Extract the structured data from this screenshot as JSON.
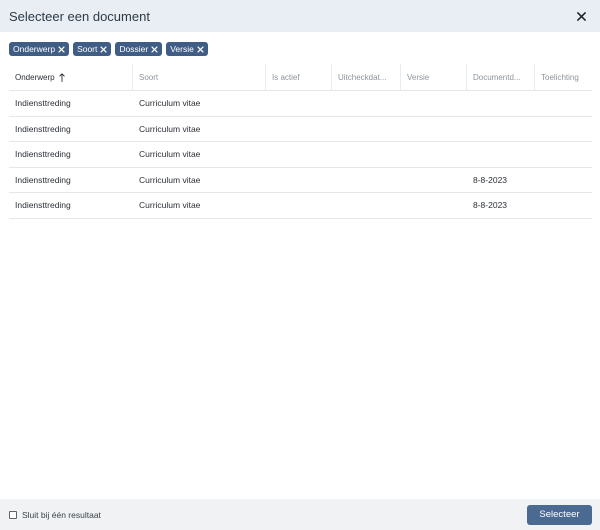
{
  "dialog": {
    "title": "Selecteer een document"
  },
  "filters": [
    {
      "label": "Onderwerp"
    },
    {
      "label": "Soort"
    },
    {
      "label": "Dossier"
    },
    {
      "label": "Versie"
    }
  ],
  "table": {
    "columns": [
      {
        "label": "Onderwerp",
        "sorted": "ascending"
      },
      {
        "label": "Soort"
      },
      {
        "label": "Is actief"
      },
      {
        "label": "Uitcheckdat..."
      },
      {
        "label": "Versie"
      },
      {
        "label": "Documentd..."
      },
      {
        "label": "Toelichting"
      }
    ],
    "rows": [
      {
        "cells": [
          "Indiensttreding",
          "Curriculum vitae",
          "",
          "",
          "",
          "",
          ""
        ]
      },
      {
        "cells": [
          "Indiensttreding",
          "Curriculum vitae",
          "",
          "",
          "",
          "",
          ""
        ]
      },
      {
        "cells": [
          "Indiensttreding",
          "Curriculum vitae",
          "",
          "",
          "",
          "",
          ""
        ]
      },
      {
        "cells": [
          "Indiensttreding",
          "Curriculum vitae",
          "",
          "",
          "",
          "8-8-2023",
          ""
        ]
      },
      {
        "cells": [
          "Indiensttreding",
          "Curriculum vitae",
          "",
          "",
          "",
          "8-8-2023",
          ""
        ]
      }
    ]
  },
  "footer": {
    "checkbox_label": "Sluit bij één resultaat",
    "checkbox_checked": false,
    "select_button": "Selecteer"
  },
  "colors": {
    "header_bg": "#e8eef4",
    "chip_bg": "#3f5d85",
    "primary_button": "#4b6a92",
    "footer_bg": "#f0f2f4"
  },
  "icons": {
    "close": "close-icon",
    "chip_remove": "close-icon",
    "sort": "arrow-up-icon"
  }
}
